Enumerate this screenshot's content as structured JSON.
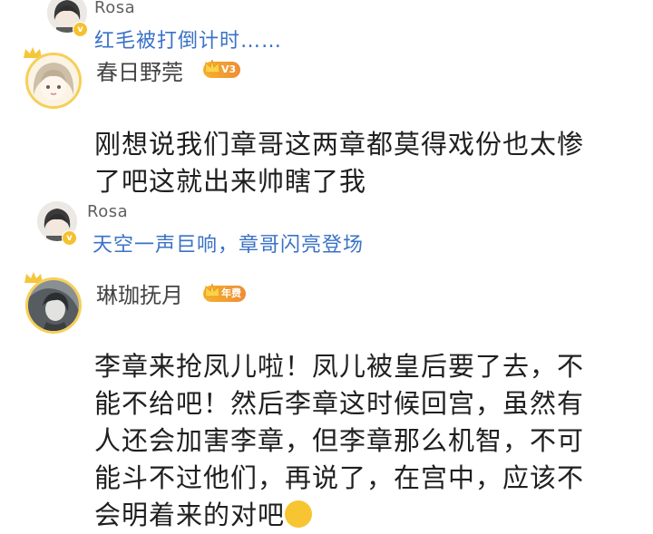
{
  "replies": [
    {
      "user": "Rosa",
      "text": "红毛被打倒计时……",
      "badge": "v"
    },
    {
      "user": "Rosa",
      "text": "天空一声巨响，章哥闪亮登场",
      "badge": "v"
    }
  ],
  "comments": [
    {
      "user": "春日野莞",
      "level_badge": "V3",
      "lines": [
        "刚想说我们章哥这两章都莫得戏份也太惨",
        "了吧这就出来帅瞎了我"
      ]
    },
    {
      "user": "琳珈抚月",
      "level_badge": "年费",
      "lines": [
        "李章来抢凤儿啦！凤儿被皇后要了去，不",
        "能不给吧！然后李章这时候回宫，虽然有",
        "人还会加害李章，但李章那么机智，不可",
        "能斗不过他们，再说了，在宫中，应该不",
        "会明着来的对吧"
      ]
    }
  ],
  "colors": {
    "reply_link": "#3a72c6",
    "badge_gold": "#f6c12e",
    "avatar_frame": "#f6cf57"
  }
}
